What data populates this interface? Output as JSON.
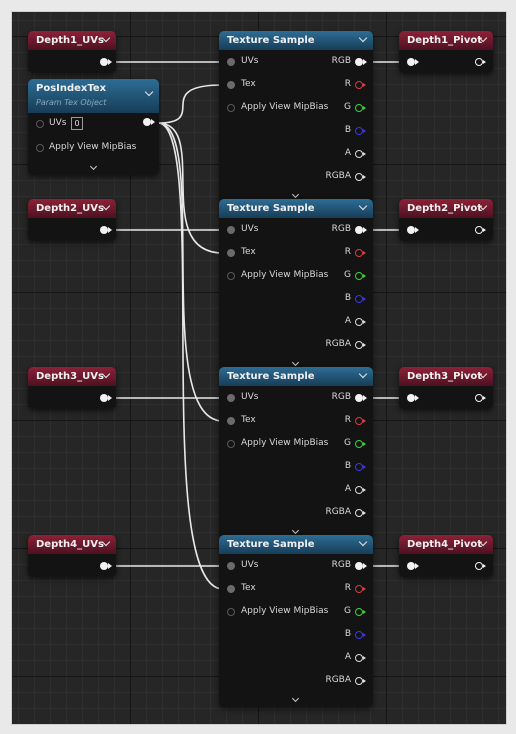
{
  "colors": {
    "param_header": "#8e2038",
    "texture_header": "#2d6d95",
    "pin_red": "#e23a3a",
    "pin_green": "#37d43c",
    "pin_blue": "#3a3ae8",
    "wire": "#e8e8e8"
  },
  "icons": {
    "header_dropdown": "chevron-down-icon",
    "expand_node": "chevron-down-icon",
    "pin_connected": "filled-pin-icon",
    "pin_disconnected": "hollow-pin-icon"
  },
  "uv_params": [
    {
      "title": "Depth1_UVs"
    },
    {
      "title": "Depth2_UVs"
    },
    {
      "title": "Depth3_UVs"
    },
    {
      "title": "Depth4_UVs"
    }
  ],
  "pivot_params": [
    {
      "title": "Depth1_Pivot"
    },
    {
      "title": "Depth2_Pivot"
    },
    {
      "title": "Depth3_Pivot"
    },
    {
      "title": "Depth4_Pivot"
    }
  ],
  "tex_object": {
    "title": "PosIndexTex",
    "subtitle": "Param Tex Object",
    "uvs_label": "UVs",
    "uvs_value": "0",
    "mip_label": "Apply View MipBias"
  },
  "texture_sample": {
    "title": "Texture Sample",
    "inputs": {
      "uvs": "UVs",
      "tex": "Tex",
      "mip": "Apply View MipBias"
    },
    "outputs": {
      "rgb": "RGB",
      "r": "R",
      "g": "G",
      "b": "B",
      "a": "A",
      "rgba": "RGBA"
    }
  }
}
